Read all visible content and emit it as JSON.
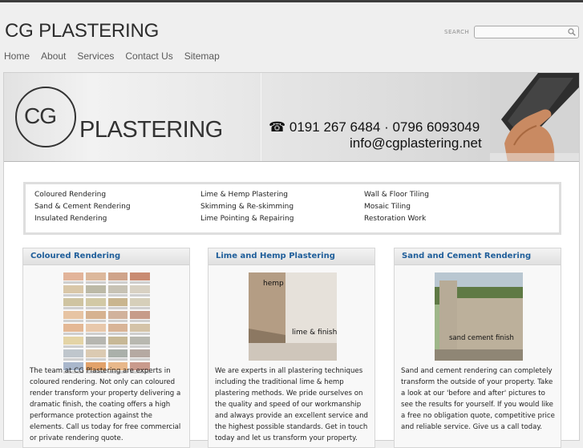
{
  "site": {
    "title": "CG PLASTERING"
  },
  "search": {
    "label": "SEARCH",
    "placeholder": ""
  },
  "nav": [
    "Home",
    "About",
    "Services",
    "Contact Us",
    "Sitemap"
  ],
  "banner": {
    "logo_initials": "CG",
    "logo_word": "PLASTERING",
    "phone": "☎ 0191 267 6484 · 0796 6093049",
    "email": "info@cgplastering.net"
  },
  "services": [
    [
      "Coloured Rendering",
      "Lime & Hemp Plastering",
      "Wall & Floor Tiling"
    ],
    [
      "Sand & Cement Rendering",
      "Skimming & Re-skimming",
      "Mosaic Tiling"
    ],
    [
      "Insulated Rendering",
      "Lime Pointing & Repairing",
      "Restoration Work"
    ]
  ],
  "panels": [
    {
      "title": "Coloured Rendering",
      "text": "The team at CG Plastering are experts in coloured rendering. Not only can coloured render transform your property delivering a dramatic finish, the coating offers a high performance protection against the elements. Call us today for free commercial or private rendering quote."
    },
    {
      "title": "Lime and Hemp Plastering",
      "image_labels": [
        "hemp",
        "lime & finish"
      ],
      "text": "We are experts in all plastering techniques including the traditional lime & hemp plastering methods. We pride ourselves on the quality and speed of our workmanship and always provide an excellent service and the highest possible standards. Get in touch today and let us transform your property."
    },
    {
      "title": "Sand and Cement Rendering",
      "image_labels": [
        "sand cement finish"
      ],
      "text": "Sand and cement rendering can completely transform the outside of your property. Take a look at our 'before and after' pictures to see the results for yourself. If you would like a free no obligation quote, competitive price and reliable service. Give us a call today."
    }
  ],
  "swatch_colors": [
    "#e2b49a",
    "#dcb89c",
    "#cfa48a",
    "#c98b72",
    "#d9c7a8",
    "#bcb9a6",
    "#c7c2b4",
    "#d8d1c3",
    "#cfc4a1",
    "#d2c9a5",
    "#c9b58f",
    "#d6cfba",
    "#e7c4a3",
    "#d6b290",
    "#d1b29c",
    "#c79c8a",
    "#e4b895",
    "#e8c8ab",
    "#d8b497",
    "#d4c3a8",
    "#e4d4a6",
    "#b6b6b0",
    "#c7b896",
    "#b8b8b0",
    "#bfc6cc",
    "#dbcab2",
    "#aab0aa",
    "#b5a9a2",
    "#a9b7cc",
    "#e2a26a",
    "#e8b88a",
    "#c99a8c"
  ],
  "colors": {
    "accent": "#1f5e9a",
    "topbar": "#3d3d3d",
    "text": "#222222"
  }
}
